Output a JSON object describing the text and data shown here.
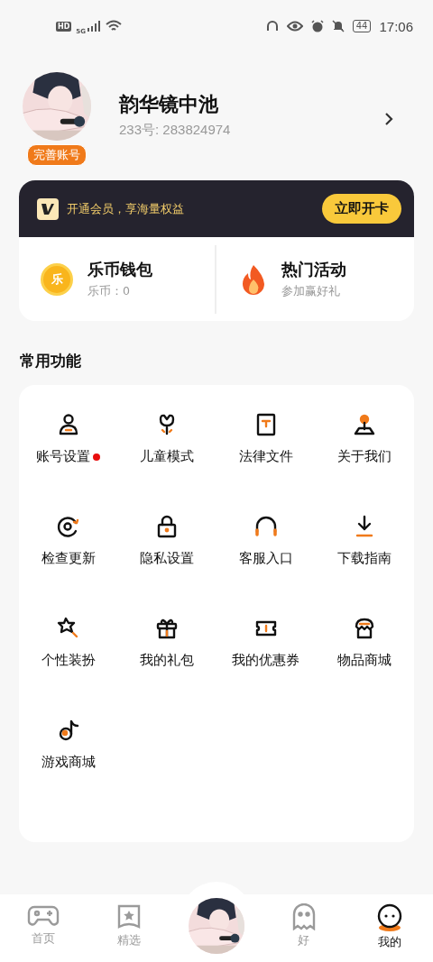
{
  "status_bar": {
    "time": "17:06",
    "hd": "HD",
    "network": "5G",
    "battery": "44"
  },
  "profile": {
    "name": "韵华镜中池",
    "id_text": "233号: 283824974",
    "badge": "完善账号"
  },
  "vip": {
    "text": "开通会员，享海量权益",
    "button": "立即开卡"
  },
  "cards": [
    {
      "title": "乐币钱包",
      "subtitle": "乐币：0",
      "icon_text": "乐"
    },
    {
      "title": "热门活动",
      "subtitle": "参加赢好礼"
    }
  ],
  "section_title": "常用功能",
  "functions": [
    {
      "label": "账号设置",
      "dot": true
    },
    {
      "label": "儿童模式",
      "dot": false
    },
    {
      "label": "法律文件",
      "dot": false
    },
    {
      "label": "关于我们",
      "dot": false
    },
    {
      "label": "检查更新",
      "dot": false
    },
    {
      "label": "隐私设置",
      "dot": false
    },
    {
      "label": "客服入口",
      "dot": false
    },
    {
      "label": "下载指南",
      "dot": false
    },
    {
      "label": "个性装扮",
      "dot": false
    },
    {
      "label": "我的礼包",
      "dot": false
    },
    {
      "label": "我的优惠券",
      "dot": false
    },
    {
      "label": "物品商城",
      "dot": false
    },
    {
      "label": "游戏商城",
      "dot": false
    }
  ],
  "bottom_nav": [
    {
      "kind": "tab",
      "label": "首页",
      "selected": false
    },
    {
      "kind": "tab",
      "label": "精选",
      "selected": false
    },
    {
      "kind": "avatar"
    },
    {
      "kind": "tab",
      "label": "好",
      "selected": false
    },
    {
      "kind": "tab",
      "label": "我的",
      "selected": true
    }
  ]
}
